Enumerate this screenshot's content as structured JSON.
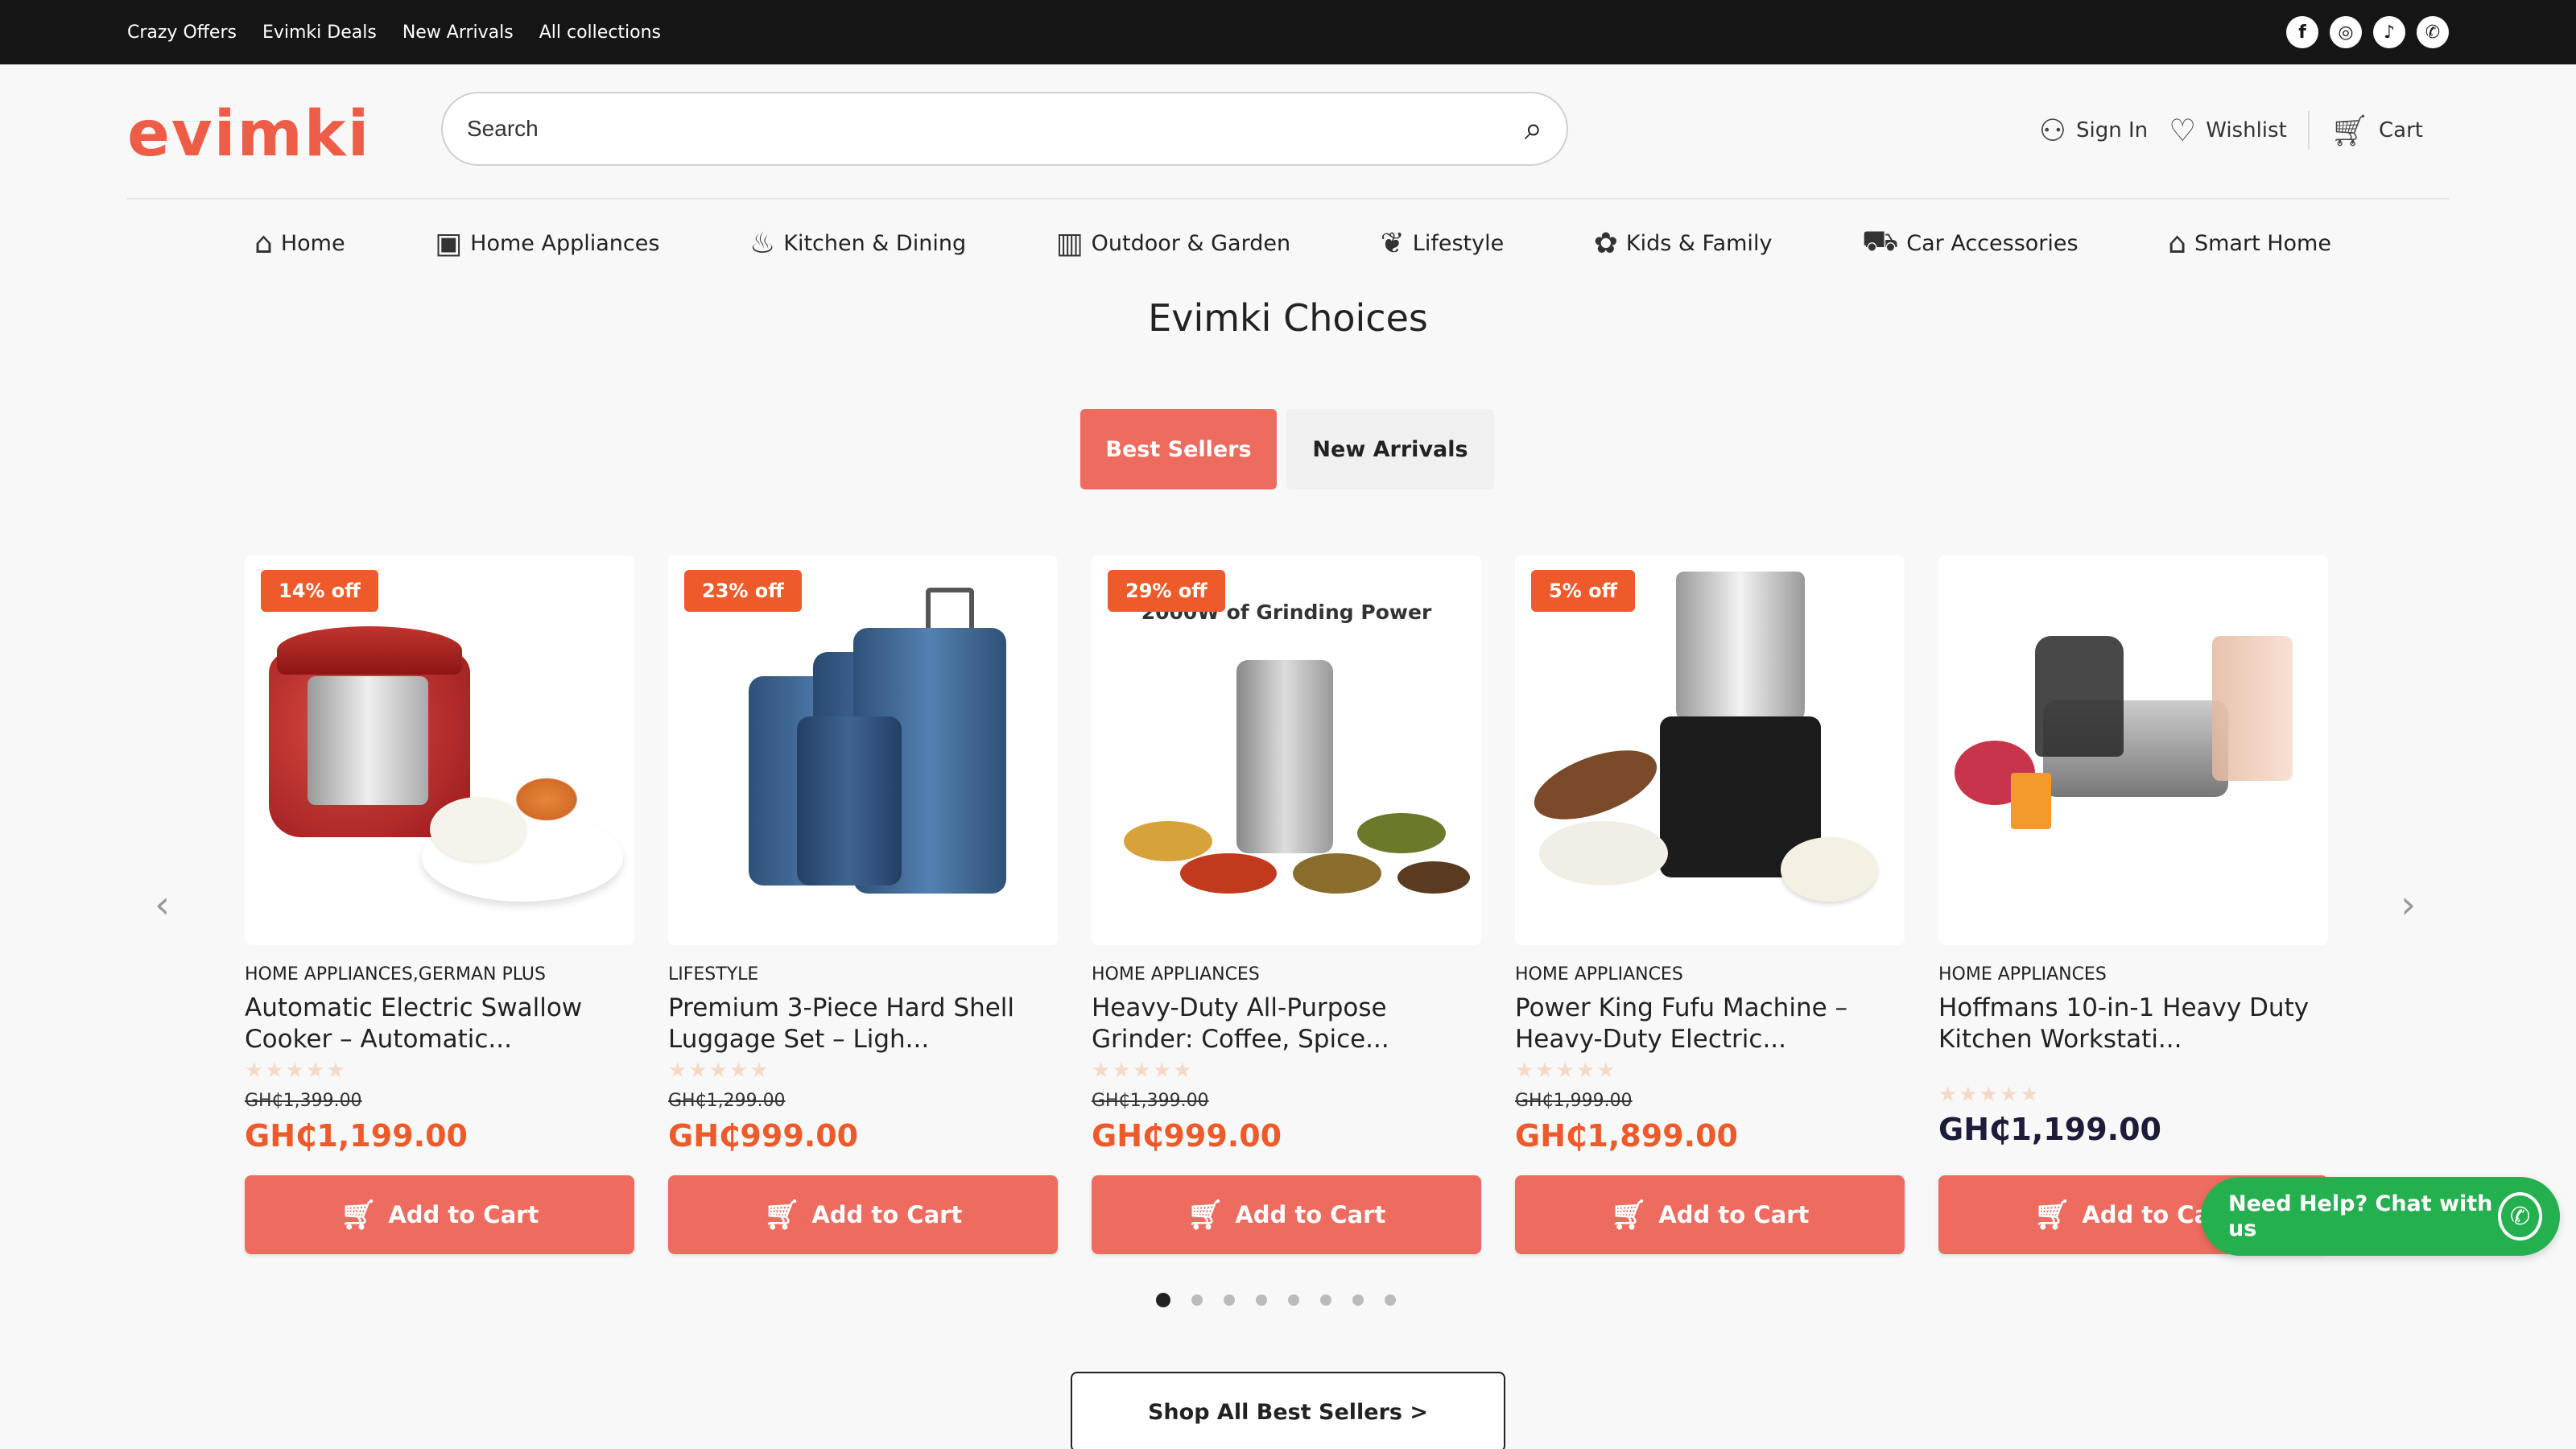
{
  "topbar": {
    "links": [
      "Crazy Offers",
      "Evimki Deals",
      "New Arrivals",
      "All collections"
    ],
    "social_icons": [
      "facebook-icon",
      "instagram-icon",
      "tiktok-icon",
      "whatsapp-icon"
    ]
  },
  "header": {
    "logo": "evimki",
    "search_placeholder": "Search",
    "sign_in": "Sign In",
    "wishlist": "Wishlist",
    "cart": "Cart"
  },
  "nav": [
    "Home",
    "Home Appliances",
    "Kitchen & Dining",
    "Outdoor & Garden",
    "Lifestyle",
    "Kids & Family",
    "Car Accessories",
    "Smart Home"
  ],
  "section": {
    "title": "Evimki Choices",
    "tabs": {
      "active": "Best Sellers",
      "inactive": "New Arrivals"
    }
  },
  "products": [
    {
      "badge": "14% off",
      "category": "HOME APPLIANCES,GERMAN PLUS",
      "title": "Automatic Electric Swallow Cooker – Automatic...",
      "stars": "★★★★★",
      "old_price": "GH₵1,399.00",
      "price": "GH₵1,199.00",
      "button": "Add to Cart"
    },
    {
      "badge": "23% off",
      "category": "LIFESTYLE",
      "title": "Premium 3-Piece Hard Shell Luggage Set – Ligh...",
      "stars": "★★★★★",
      "old_price": "GH₵1,299.00",
      "price": "GH₵999.00",
      "button": "Add to Cart"
    },
    {
      "badge": "29% off",
      "category": "HOME APPLIANCES",
      "title": "Heavy-Duty All-Purpose Grinder: Coffee, Spice...",
      "stars": "★★★★★",
      "old_price": "GH₵1,399.00",
      "price": "GH₵999.00",
      "button": "Add to Cart",
      "image_text": "2000W of Grinding Power"
    },
    {
      "badge": "5% off",
      "category": "HOME APPLIANCES",
      "title": "Power King Fufu Machine – Heavy-Duty Electric...",
      "stars": "★★★★★",
      "old_price": "GH₵1,999.00",
      "price": "GH₵1,899.00",
      "button": "Add to Cart"
    },
    {
      "badge": "",
      "category": "HOME APPLIANCES",
      "title": "Hoffmans 10-in-1 Heavy Duty Kitchen Workstati...",
      "stars": "★★★★★",
      "old_price": "",
      "price": "GH₵1,199.00",
      "button": "Add to Cart"
    }
  ],
  "pagination": {
    "count": 8,
    "active": 1
  },
  "shop_all": "Shop All Best Sellers >",
  "chat": "Need Help? Chat with us",
  "colors": {
    "accent": "#ee6c5f",
    "badge": "#ee5a2a",
    "topbar": "#161616",
    "chat": "#25b050"
  }
}
